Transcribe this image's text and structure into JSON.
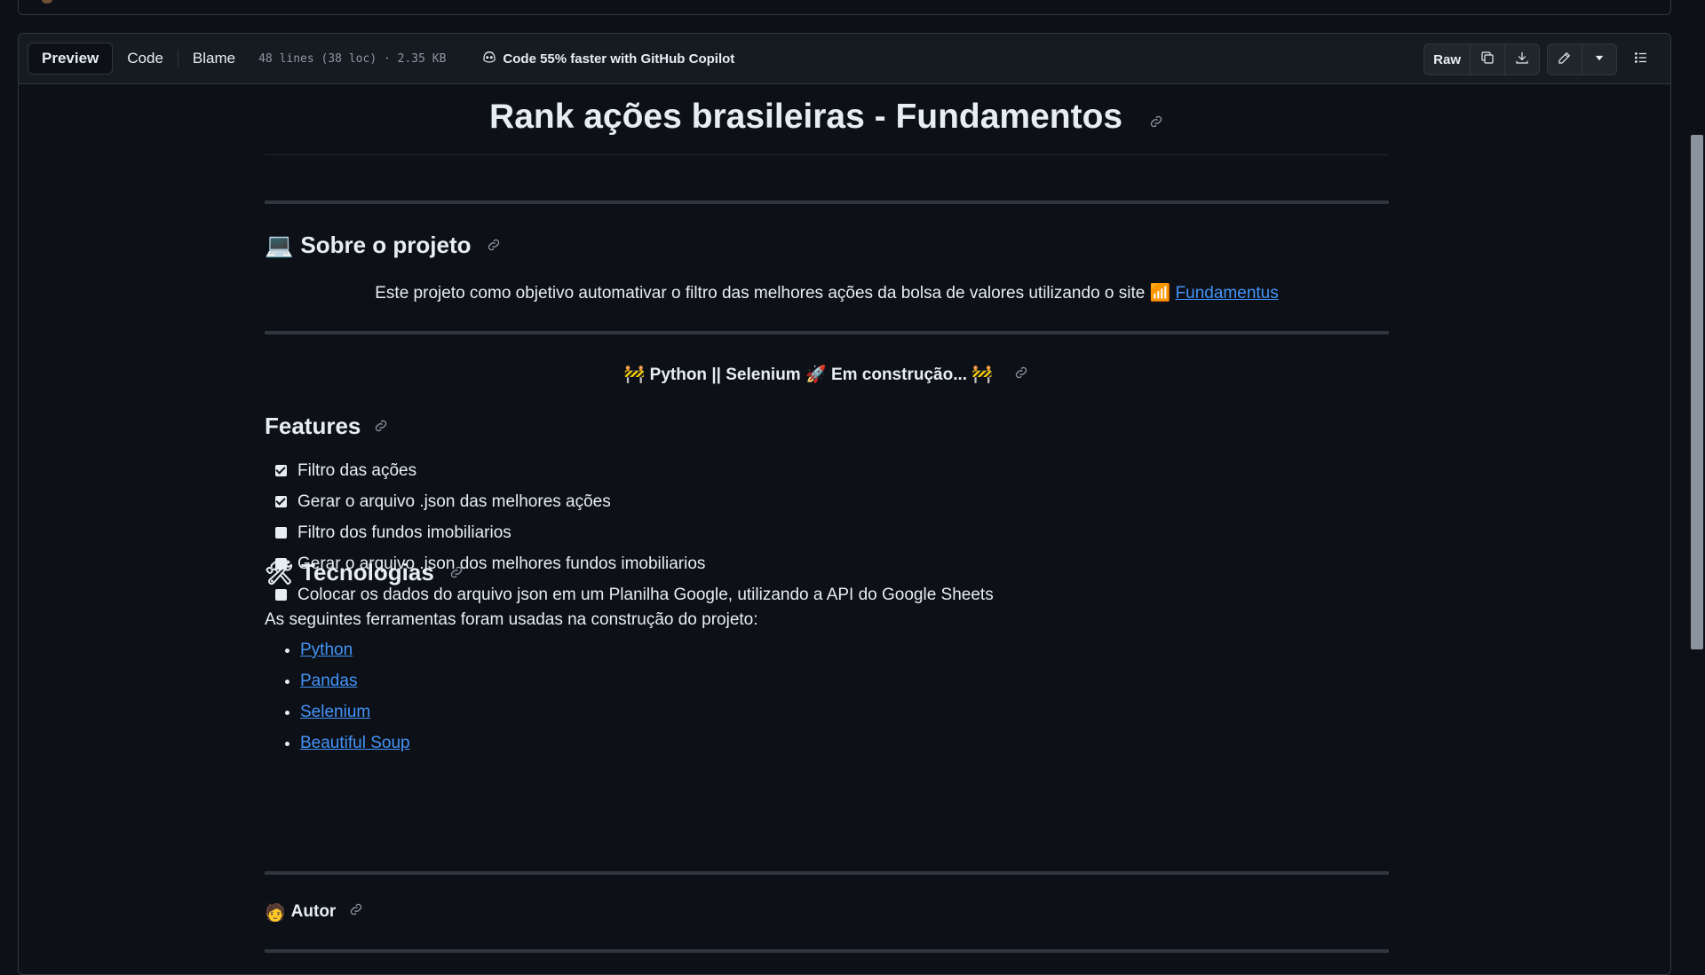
{
  "header": {
    "tabs": [
      {
        "label": "Preview",
        "active": true
      },
      {
        "label": "Code",
        "active": false
      },
      {
        "label": "Blame",
        "active": false
      }
    ],
    "meta": "48 lines (38 loc) · 2.35 KB",
    "copilot": "Code 55% faster with GitHub Copilot",
    "raw_label": "Raw",
    "icons": [
      "copy-icon",
      "download-icon",
      "pencil-icon",
      "triangle-down-icon",
      "list-unordered-icon"
    ]
  },
  "readme": {
    "title": "Rank ações brasileiras - Fundamentos",
    "about": {
      "emoji": "💻",
      "heading": "Sobre o projeto",
      "text": "Este projeto como objetivo automativar o filtro das melhores ações da bolsa de valores utilizando o site ",
      "link_emoji": "📶",
      "link_label": "Fundamentus"
    },
    "banner": {
      "emoji_left": "🚧",
      "text": "Python || Selenium",
      "rocket": "🚀",
      "text2": "Em construção...",
      "emoji_right": "🚧"
    },
    "features": {
      "heading": "Features",
      "items": [
        {
          "label": "Filtro das ações",
          "checked": true
        },
        {
          "label": "Gerar o arquivo .json das melhores ações",
          "checked": true
        },
        {
          "label": "Filtro dos fundos imobiliarios",
          "checked": false
        },
        {
          "label": "Gerar o arquivo .json dos melhores fundos imobiliarios",
          "checked": false
        },
        {
          "label": "Colocar os dados do arquivo json em um Planilha Google, utilizando a API do Google Sheets",
          "checked": false
        }
      ]
    },
    "tech": {
      "emoji": "🛠",
      "heading": "Tecnologias",
      "intro": "As seguintes ferramentas foram usadas na construção do projeto:",
      "items": [
        "Python",
        "Pandas",
        "Selenium",
        "Beautiful Soup"
      ]
    },
    "author": {
      "emoji": "🧑",
      "heading": "Autor"
    }
  },
  "colors": {
    "background": "#0d1117",
    "text": "#e6edf3",
    "link": "#4493f8",
    "muted": "#8d96a0",
    "border": "#30363d"
  }
}
